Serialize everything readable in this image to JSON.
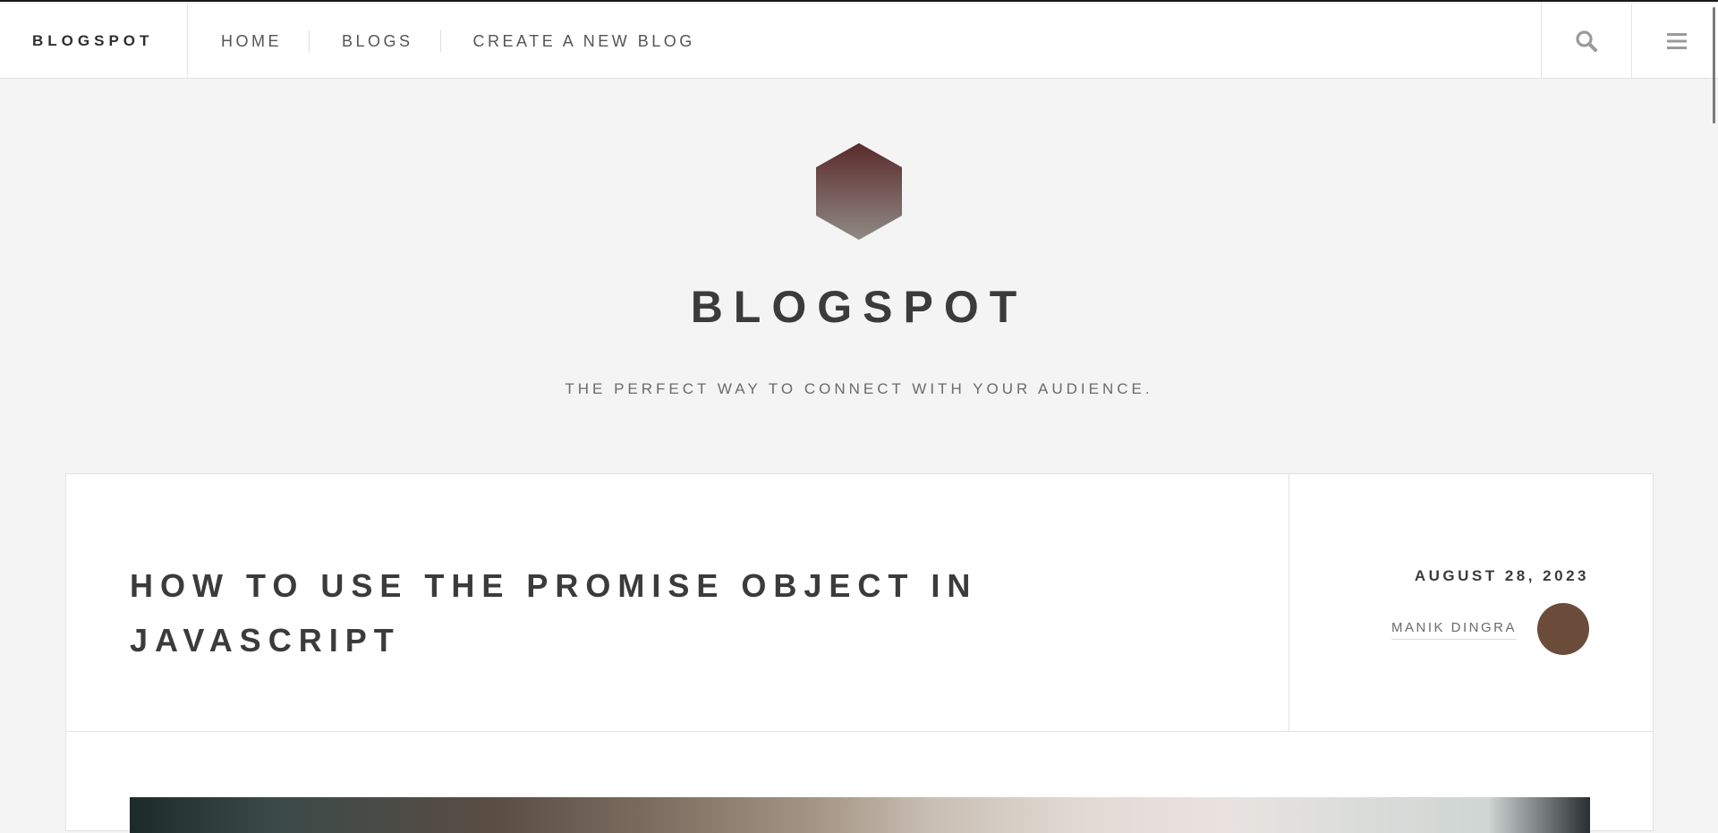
{
  "header": {
    "brand": "BLOGSPOT",
    "nav": [
      {
        "label": "HOME"
      },
      {
        "label": "BLOGS"
      },
      {
        "label": "CREATE A NEW BLOG"
      }
    ],
    "icons": [
      "search-icon",
      "hamburger-menu-icon"
    ]
  },
  "intro": {
    "logo_icon": "hexagon-logo-icon",
    "title": "BLOGSPOT",
    "tagline": "THE PERFECT WAY TO CONNECT WITH YOUR AUDIENCE."
  },
  "post": {
    "title": "HOW TO USE THE PROMISE OBJECT IN JAVASCRIPT",
    "date": "AUGUST 28, 2023",
    "author": "MANIK DINGRA"
  },
  "colors": {
    "background": "#f4f4f4",
    "text": "#3c3b3b",
    "logo_top": "#5a2a2a",
    "logo_bottom": "#8f8a85",
    "avatar": "#6b4c3a"
  }
}
